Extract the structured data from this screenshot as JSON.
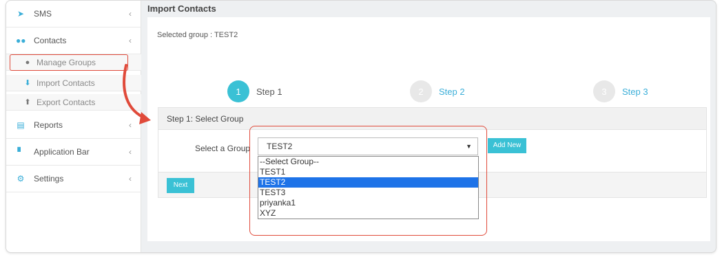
{
  "sidebar": {
    "items": [
      {
        "label": "SMS",
        "icon": "send-icon"
      },
      {
        "label": "Contacts",
        "icon": "users-icon"
      },
      {
        "label": "Reports",
        "icon": "file-icon"
      },
      {
        "label": "Application Bar",
        "icon": "cart-icon"
      },
      {
        "label": "Settings",
        "icon": "cogs-icon"
      }
    ],
    "contacts_sub": [
      {
        "label": "Manage Groups",
        "icon": "users-icon"
      },
      {
        "label": "Import Contacts",
        "icon": "download-icon"
      },
      {
        "label": "Export Contacts",
        "icon": "upload-icon"
      }
    ]
  },
  "header": {
    "title": "Import Contacts"
  },
  "selected_group_text": "Selected group : TEST2",
  "steps": [
    {
      "number": "1",
      "label": "Step 1"
    },
    {
      "number": "2",
      "label": "Step 2"
    },
    {
      "number": "3",
      "label": "Step 3"
    }
  ],
  "step_box": {
    "heading": "Step 1: Select Group",
    "select_label": "Select a Group",
    "select_value": "TEST2",
    "add_button": "Add New",
    "next_button": "Next"
  },
  "dropdown_options": [
    "--Select Group--",
    "TEST1",
    "TEST2",
    "TEST3",
    "priyanka1",
    "XYZ"
  ],
  "colors": {
    "accent": "#3ac1d5",
    "highlight": "#e04a3a",
    "selected_option": "#1e73e8"
  }
}
